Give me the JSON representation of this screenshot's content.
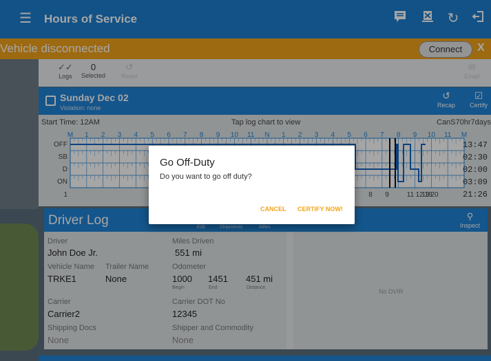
{
  "appbar": {
    "title": "Hours of Service",
    "icons": [
      "menu-icon",
      "message-icon",
      "report-icon",
      "refresh-icon",
      "logout-icon"
    ]
  },
  "banner": {
    "text": "Vehicle disconnected",
    "connect_label": "Connect",
    "close_label": "X",
    "color": "#f2a41b"
  },
  "toolbar": {
    "logs_label": "Logs",
    "selected_count": "0",
    "selected_label": "Selected",
    "reset_label": "Reset",
    "email_label": "Email"
  },
  "datebar": {
    "date": "Sunday Dec 02",
    "violation": "Violation: none",
    "recap_label": "Recap",
    "certify_label": "Certify"
  },
  "chart": {
    "start_time": "Start Time: 12AM",
    "tap_hint": "Tap log chart to view",
    "ruleset": "CanS70hr7days",
    "top_ticks": [
      "M",
      "1",
      "2",
      "3",
      "4",
      "5",
      "6",
      "7",
      "8",
      "9",
      "10",
      "11",
      "N",
      "1",
      "2",
      "3",
      "4",
      "5",
      "6",
      "7",
      "8",
      "9",
      "10",
      "11",
      "M"
    ],
    "rows": [
      "OFF",
      "SB",
      "D",
      "ON"
    ],
    "totals": [
      "13:47",
      "02:30",
      "02:00",
      "03:09"
    ],
    "grand_total": "21:26",
    "bottom_left": "1",
    "bottom_ticks": [
      "8",
      "9",
      "11",
      "12",
      "13",
      "18",
      "20"
    ]
  },
  "driver_log": {
    "title": "Driver Log",
    "tabs": [
      "Edit",
      "Shipments",
      "Miles"
    ],
    "inspect_label": "Inspect",
    "driver_label": "Driver",
    "driver": "John Doe Jr.",
    "miles_label": "Miles Driven",
    "miles": "551 mi",
    "vehicle_label": "Vehicle Name",
    "vehicle": "TRKE1",
    "trailer_label": "Trailer Name",
    "trailer": "None",
    "odometer_label": "Odometer",
    "odo_begin": "1000",
    "odo_end": "1451",
    "odo_distance": "451 mi",
    "begin_label": "Begin",
    "end_label": "End",
    "distance_label": "Distance",
    "carrier_label": "Carrier",
    "carrier": "Carrier2",
    "dot_label": "Carrier DOT No",
    "dot": "12345",
    "shipping_label": "Shipping Docs",
    "shipping": "None",
    "shipper_label": "Shipper and Commodity",
    "shipper": "None",
    "no_dvir": "No DVIR"
  },
  "dialog": {
    "title": "Go Off-Duty",
    "message": "Do you want to go off duty?",
    "cancel_label": "CANCEL",
    "certify_label": "CERTIFY NOW!",
    "accent": "#f2a41b"
  }
}
